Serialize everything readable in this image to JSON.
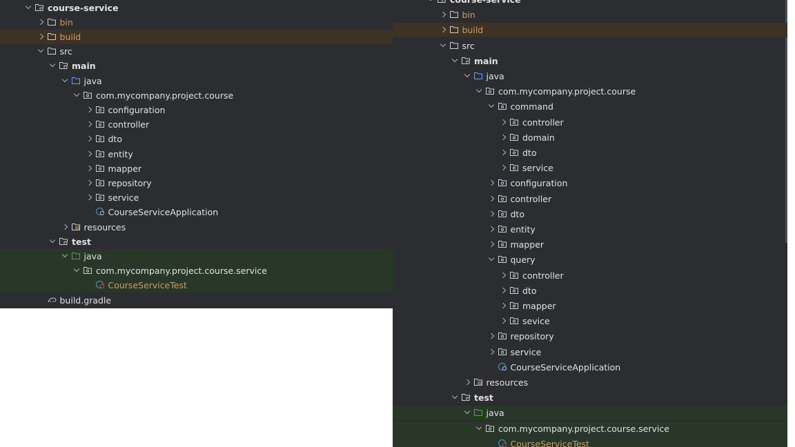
{
  "colors": {
    "panel_bg": "#2b2d30",
    "text": "#dfe1e5",
    "excluded_text": "#d29a5b",
    "excluded_row_bg": "#3d3223",
    "test_row_bg": "#293729",
    "folder_blue": "#6b9eff",
    "test_folder_green": "#57a64a",
    "class_blue": "#3592c4"
  },
  "left_tree": [
    {
      "label": "course-service",
      "depth": 0,
      "chevron": "down",
      "icon": "module-folder-icon",
      "bold": true,
      "hl": "",
      "color": ""
    },
    {
      "label": "bin",
      "depth": 1,
      "chevron": "right",
      "icon": "folder-icon",
      "bold": false,
      "hl": "",
      "color": "orange"
    },
    {
      "label": "build",
      "depth": 1,
      "chevron": "right",
      "icon": "folder-icon",
      "bold": false,
      "hl": "hl-orange",
      "color": "orange"
    },
    {
      "label": "src",
      "depth": 1,
      "chevron": "down",
      "icon": "folder-icon",
      "bold": false,
      "hl": "",
      "color": ""
    },
    {
      "label": "main",
      "depth": 2,
      "chevron": "down",
      "icon": "module-folder-icon",
      "bold": true,
      "hl": "",
      "color": ""
    },
    {
      "label": "java",
      "depth": 3,
      "chevron": "down",
      "icon": "source-folder-icon",
      "bold": false,
      "hl": "",
      "color": ""
    },
    {
      "label": "com.mycompany.project.course",
      "depth": 4,
      "chevron": "down",
      "icon": "package-icon",
      "bold": false,
      "hl": "",
      "color": ""
    },
    {
      "label": "configuration",
      "depth": 5,
      "chevron": "right",
      "icon": "package-icon",
      "bold": false,
      "hl": "",
      "color": ""
    },
    {
      "label": "controller",
      "depth": 5,
      "chevron": "right",
      "icon": "package-icon",
      "bold": false,
      "hl": "",
      "color": ""
    },
    {
      "label": "dto",
      "depth": 5,
      "chevron": "right",
      "icon": "package-icon",
      "bold": false,
      "hl": "",
      "color": ""
    },
    {
      "label": "entity",
      "depth": 5,
      "chevron": "right",
      "icon": "package-icon",
      "bold": false,
      "hl": "",
      "color": ""
    },
    {
      "label": "mapper",
      "depth": 5,
      "chevron": "right",
      "icon": "package-icon",
      "bold": false,
      "hl": "",
      "color": ""
    },
    {
      "label": "repository",
      "depth": 5,
      "chevron": "right",
      "icon": "package-icon",
      "bold": false,
      "hl": "",
      "color": ""
    },
    {
      "label": "service",
      "depth": 5,
      "chevron": "right",
      "icon": "package-icon",
      "bold": false,
      "hl": "",
      "color": ""
    },
    {
      "label": "CourseServiceApplication",
      "depth": 5,
      "chevron": "",
      "icon": "spring-class-icon",
      "bold": false,
      "hl": "",
      "color": ""
    },
    {
      "label": "resources",
      "depth": 3,
      "chevron": "right",
      "icon": "resources-folder-icon",
      "bold": false,
      "hl": "",
      "color": ""
    },
    {
      "label": "test",
      "depth": 2,
      "chevron": "down",
      "icon": "module-folder-icon",
      "bold": true,
      "hl": "",
      "color": ""
    },
    {
      "label": "java",
      "depth": 3,
      "chevron": "down",
      "icon": "test-folder-icon",
      "bold": false,
      "hl": "hl-green",
      "color": ""
    },
    {
      "label": "com.mycompany.project.course.service",
      "depth": 4,
      "chevron": "down",
      "icon": "package-icon",
      "bold": false,
      "hl": "hl-green",
      "color": ""
    },
    {
      "label": "CourseServiceTest",
      "depth": 5,
      "chevron": "",
      "icon": "test-class-icon",
      "bold": false,
      "hl": "hl-green",
      "color": "orange"
    },
    {
      "label": "build.gradle",
      "depth": 1,
      "chevron": "",
      "icon": "gradle-icon",
      "bold": false,
      "hl": "",
      "color": ""
    }
  ],
  "right_tree": [
    {
      "label": "course-service",
      "depth": 0,
      "chevron": "down",
      "icon": "module-folder-icon",
      "bold": true,
      "hl": "",
      "color": ""
    },
    {
      "label": "bin",
      "depth": 1,
      "chevron": "right",
      "icon": "folder-icon",
      "bold": false,
      "hl": "",
      "color": "orange"
    },
    {
      "label": "build",
      "depth": 1,
      "chevron": "right",
      "icon": "folder-icon",
      "bold": false,
      "hl": "hl-orange",
      "color": "orange"
    },
    {
      "label": "src",
      "depth": 1,
      "chevron": "down",
      "icon": "folder-icon",
      "bold": false,
      "hl": "",
      "color": ""
    },
    {
      "label": "main",
      "depth": 2,
      "chevron": "down",
      "icon": "module-folder-icon",
      "bold": true,
      "hl": "",
      "color": ""
    },
    {
      "label": "java",
      "depth": 3,
      "chevron": "down",
      "icon": "source-folder-icon",
      "bold": false,
      "hl": "",
      "color": ""
    },
    {
      "label": "com.mycompany.project.course",
      "depth": 4,
      "chevron": "down",
      "icon": "package-icon",
      "bold": false,
      "hl": "",
      "color": ""
    },
    {
      "label": "command",
      "depth": 5,
      "chevron": "down",
      "icon": "package-icon",
      "bold": false,
      "hl": "",
      "color": ""
    },
    {
      "label": "controller",
      "depth": 6,
      "chevron": "right",
      "icon": "package-icon",
      "bold": false,
      "hl": "",
      "color": ""
    },
    {
      "label": "domain",
      "depth": 6,
      "chevron": "right",
      "icon": "package-icon",
      "bold": false,
      "hl": "",
      "color": ""
    },
    {
      "label": "dto",
      "depth": 6,
      "chevron": "right",
      "icon": "package-icon",
      "bold": false,
      "hl": "",
      "color": ""
    },
    {
      "label": "service",
      "depth": 6,
      "chevron": "right",
      "icon": "package-icon",
      "bold": false,
      "hl": "",
      "color": ""
    },
    {
      "label": "configuration",
      "depth": 5,
      "chevron": "right",
      "icon": "package-icon",
      "bold": false,
      "hl": "",
      "color": ""
    },
    {
      "label": "controller",
      "depth": 5,
      "chevron": "right",
      "icon": "package-icon",
      "bold": false,
      "hl": "",
      "color": ""
    },
    {
      "label": "dto",
      "depth": 5,
      "chevron": "right",
      "icon": "package-icon",
      "bold": false,
      "hl": "",
      "color": ""
    },
    {
      "label": "entity",
      "depth": 5,
      "chevron": "right",
      "icon": "package-icon",
      "bold": false,
      "hl": "",
      "color": ""
    },
    {
      "label": "mapper",
      "depth": 5,
      "chevron": "right",
      "icon": "package-icon",
      "bold": false,
      "hl": "",
      "color": ""
    },
    {
      "label": "query",
      "depth": 5,
      "chevron": "down",
      "icon": "package-icon",
      "bold": false,
      "hl": "",
      "color": ""
    },
    {
      "label": "controller",
      "depth": 6,
      "chevron": "right",
      "icon": "package-icon",
      "bold": false,
      "hl": "",
      "color": ""
    },
    {
      "label": "dto",
      "depth": 6,
      "chevron": "right",
      "icon": "package-icon",
      "bold": false,
      "hl": "",
      "color": ""
    },
    {
      "label": "mapper",
      "depth": 6,
      "chevron": "right",
      "icon": "package-icon",
      "bold": false,
      "hl": "",
      "color": ""
    },
    {
      "label": "sevice",
      "depth": 6,
      "chevron": "right",
      "icon": "package-icon",
      "bold": false,
      "hl": "",
      "color": ""
    },
    {
      "label": "repository",
      "depth": 5,
      "chevron": "right",
      "icon": "package-icon",
      "bold": false,
      "hl": "",
      "color": ""
    },
    {
      "label": "service",
      "depth": 5,
      "chevron": "right",
      "icon": "package-icon",
      "bold": false,
      "hl": "",
      "color": ""
    },
    {
      "label": "CourseServiceApplication",
      "depth": 5,
      "chevron": "",
      "icon": "spring-class-icon",
      "bold": false,
      "hl": "",
      "color": ""
    },
    {
      "label": "resources",
      "depth": 3,
      "chevron": "right",
      "icon": "resources-folder-icon",
      "bold": false,
      "hl": "",
      "color": ""
    },
    {
      "label": "test",
      "depth": 2,
      "chevron": "down",
      "icon": "module-folder-icon",
      "bold": true,
      "hl": "",
      "color": ""
    },
    {
      "label": "java",
      "depth": 3,
      "chevron": "down",
      "icon": "test-folder-icon",
      "bold": false,
      "hl": "hl-green",
      "color": ""
    },
    {
      "label": "com.mycompany.project.course.service",
      "depth": 4,
      "chevron": "down",
      "icon": "package-icon",
      "bold": false,
      "hl": "hl-green",
      "color": ""
    },
    {
      "label": "CourseServiceTest",
      "depth": 5,
      "chevron": "",
      "icon": "test-class-icon",
      "bold": false,
      "hl": "hl-green",
      "color": "orange"
    }
  ]
}
